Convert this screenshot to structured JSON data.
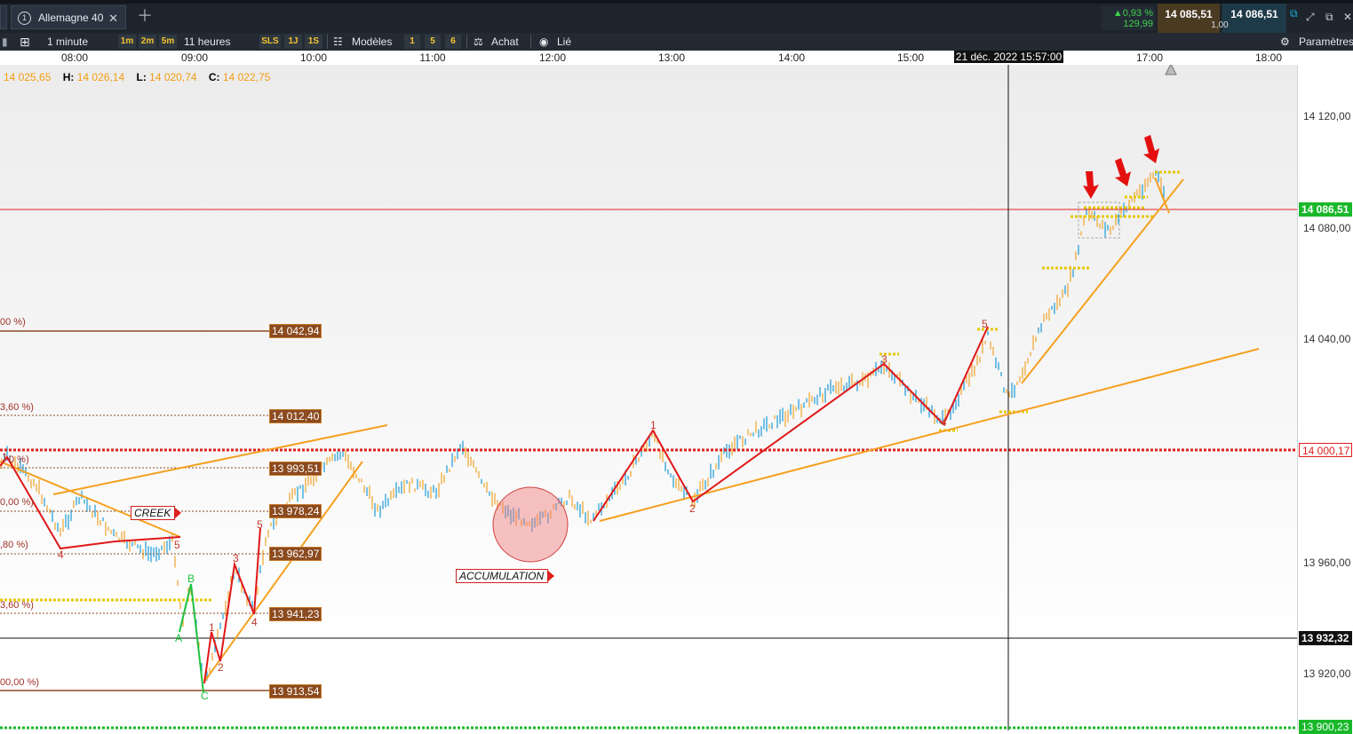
{
  "tabs": [
    {
      "number": "1",
      "label": "Allemagne 40"
    }
  ],
  "ticker": {
    "change_pct": "▲0,93 %",
    "change_abs": "129,99",
    "bid": "14 085,51",
    "ask": "14 086,51",
    "spread": "1,00"
  },
  "toolbar": {
    "interval": "1 minute",
    "timeframes": [
      "1m",
      "2m",
      "5m"
    ],
    "range": "11 heures",
    "quick_ranges": [
      "SLS",
      "1J",
      "1S"
    ],
    "models": "Modèles",
    "layouts": [
      "1",
      "5",
      "6"
    ],
    "buy": "Achat",
    "linked": "Lié",
    "settings": "Paramètres"
  },
  "time_axis": {
    "labels": [
      "08:00",
      "09:00",
      "10:00",
      "11:00",
      "12:00",
      "13:00",
      "14:00",
      "15:00",
      "17:00",
      "18:00"
    ],
    "crosshair": "21 déc. 2022 15:57:00"
  },
  "ohlc": {
    "o": "14 025,65",
    "h_label": "H:",
    "h": "14 026,14",
    "l_label": "L:",
    "l": "14 020,74",
    "c_label": "C:",
    "c": "14 022,75"
  },
  "price_axis": {
    "labels": [
      "14 120,00",
      "14 080,00",
      "14 040,00",
      "13 960,00",
      "13 920,00"
    ],
    "current": "14 086,51",
    "level": "14 000,17",
    "crosshair": "13 932,32",
    "bottom": "13 900,23"
  },
  "fib_levels": [
    "14 042,94",
    "14 012,40",
    "13 993,51",
    "13 978,24",
    "13 962,97",
    "13 941,23",
    "13 913,54"
  ],
  "fib_pct": [
    "00 %)",
    "3,60 %)",
    "0 %)",
    "0,00 %)",
    ",80 %)",
    "3,60 %)",
    "00,00 %)"
  ],
  "annotations": {
    "creek": "CREEK",
    "accumulation": "ACCUMULATION"
  },
  "wave_labels": {
    "red": [
      "4",
      "5",
      "1",
      "2",
      "3",
      "4",
      "5",
      "1",
      "2",
      "3",
      "4",
      "5",
      "1"
    ],
    "green": [
      "B",
      "A",
      "C"
    ]
  },
  "colors": {
    "up": "#1a9bd7",
    "down": "#f0a32a",
    "current": "#19b82a",
    "level": "#e02020",
    "fib": "#8b4a1f"
  }
}
